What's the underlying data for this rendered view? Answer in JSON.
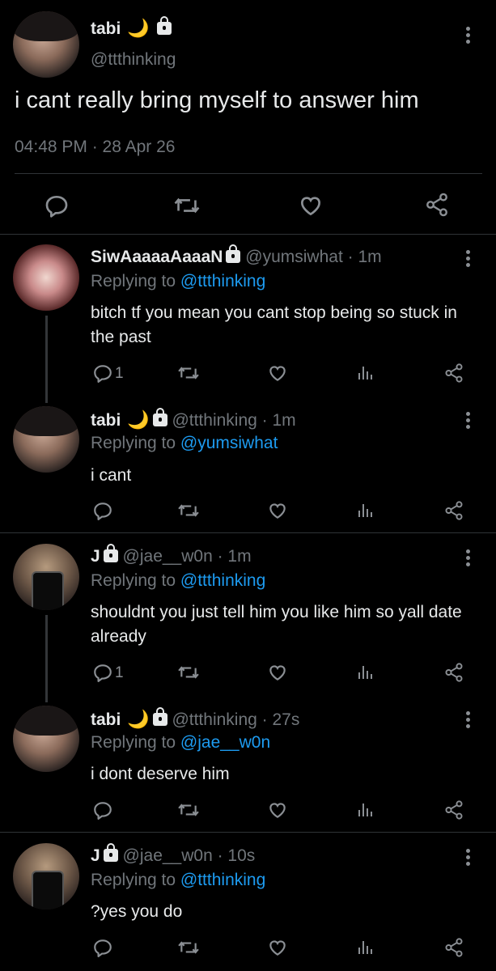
{
  "main_tweet": {
    "display_name": "tabi",
    "moon_emoji": "🌙",
    "handle": "@ttthinking",
    "text": "i cant really bring myself to answer him",
    "timestamp": "04:48 PM · 28 Apr 26"
  },
  "replies": [
    {
      "display_name": "SiwAaaaaAaaaN",
      "handle": "@yumsiwhat",
      "time": "· 1m",
      "replying_prefix": "Replying to",
      "replying_to": "@ttthinking",
      "text": "bitch tf you mean you cant stop being so stuck in the past",
      "reply_count": "1"
    },
    {
      "display_name": "tabi",
      "moon_emoji": "🌙",
      "handle": "@ttthinking",
      "time": "· 1m",
      "replying_prefix": "Replying to",
      "replying_to": "@yumsiwhat",
      "text": "i cant",
      "reply_count": ""
    },
    {
      "display_name": "J",
      "handle": "@jae__w0n",
      "time": "· 1m",
      "replying_prefix": "Replying to",
      "replying_to": "@ttthinking",
      "text": "shouldnt you just tell him you like him so yall date already",
      "reply_count": "1"
    },
    {
      "display_name": "tabi",
      "moon_emoji": "🌙",
      "handle": "@ttthinking",
      "time": "· 27s",
      "replying_prefix": "Replying to",
      "replying_to": "@jae__w0n",
      "text": "i dont deserve him",
      "reply_count": ""
    },
    {
      "display_name": "J",
      "handle": "@jae__w0n",
      "time": "· 10s",
      "replying_prefix": "Replying to",
      "replying_to": "@ttthinking",
      "text": "?yes you do",
      "reply_count": ""
    }
  ],
  "icons": {
    "reply": "reply-icon",
    "retweet": "retweet-icon",
    "like": "heart-icon",
    "analytics": "analytics-icon",
    "share": "share-icon",
    "more": "more-icon",
    "lock": "lock-icon"
  },
  "colors": {
    "background": "#000000",
    "text": "#e7e9ea",
    "muted": "#71767b",
    "link": "#1d9bf0",
    "moon": "#f4c542"
  }
}
